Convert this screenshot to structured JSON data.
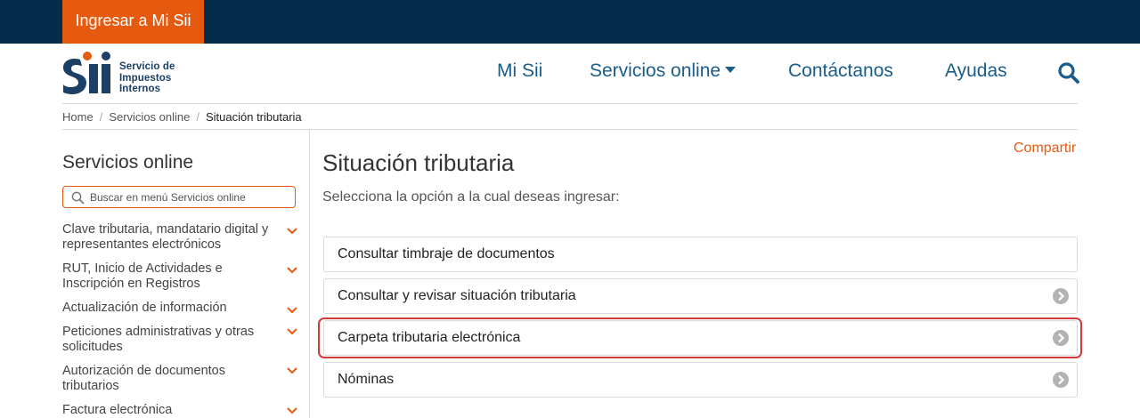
{
  "topbar": {
    "login_label": "Ingresar a Mi Sii",
    "bg_color": "#042c4b",
    "accent_color": "#e55a0f"
  },
  "logo": {
    "mark": "Sii",
    "line1": "Servicio de",
    "line2": "Impuestos",
    "line3": "Internos"
  },
  "nav": {
    "items": [
      {
        "label": "Mi Sii"
      },
      {
        "label": "Servicios online",
        "icon": "caret-down-icon"
      },
      {
        "label": "Contáctanos"
      },
      {
        "label": "Ayudas"
      }
    ],
    "search_icon": "search-icon"
  },
  "breadcrumb": {
    "items": [
      "Home",
      "Servicios online"
    ],
    "current": "Situación tributaria"
  },
  "sidebar": {
    "title": "Servicios online",
    "search_placeholder": "Buscar en menú Servicios online",
    "items": [
      {
        "label": "Clave tributaria, mandatario digital y representantes electrónicos"
      },
      {
        "label": "RUT, Inicio de Actividades e Inscripción en Registros"
      },
      {
        "label": "Actualización de información"
      },
      {
        "label": "Peticiones administrativas y otras solicitudes"
      },
      {
        "label": "Autorización de documentos tributarios"
      },
      {
        "label": "Factura electrónica"
      }
    ]
  },
  "main": {
    "title": "Situación tributaria",
    "share_label": "Compartir",
    "subtitle": "Selecciona la opción a la cual deseas ingresar:",
    "options": [
      {
        "label": "Consultar timbraje de documentos",
        "icon": ""
      },
      {
        "label": "Consultar y revisar situación tributaria",
        "icon": "arrow-circle-icon"
      },
      {
        "label": "Carpeta tributaria electrónica",
        "icon": "arrow-circle-icon",
        "highlighted": true,
        "highlight_color": "#d33a37"
      },
      {
        "label": "Nóminas",
        "icon": "arrow-circle-icon"
      }
    ]
  }
}
